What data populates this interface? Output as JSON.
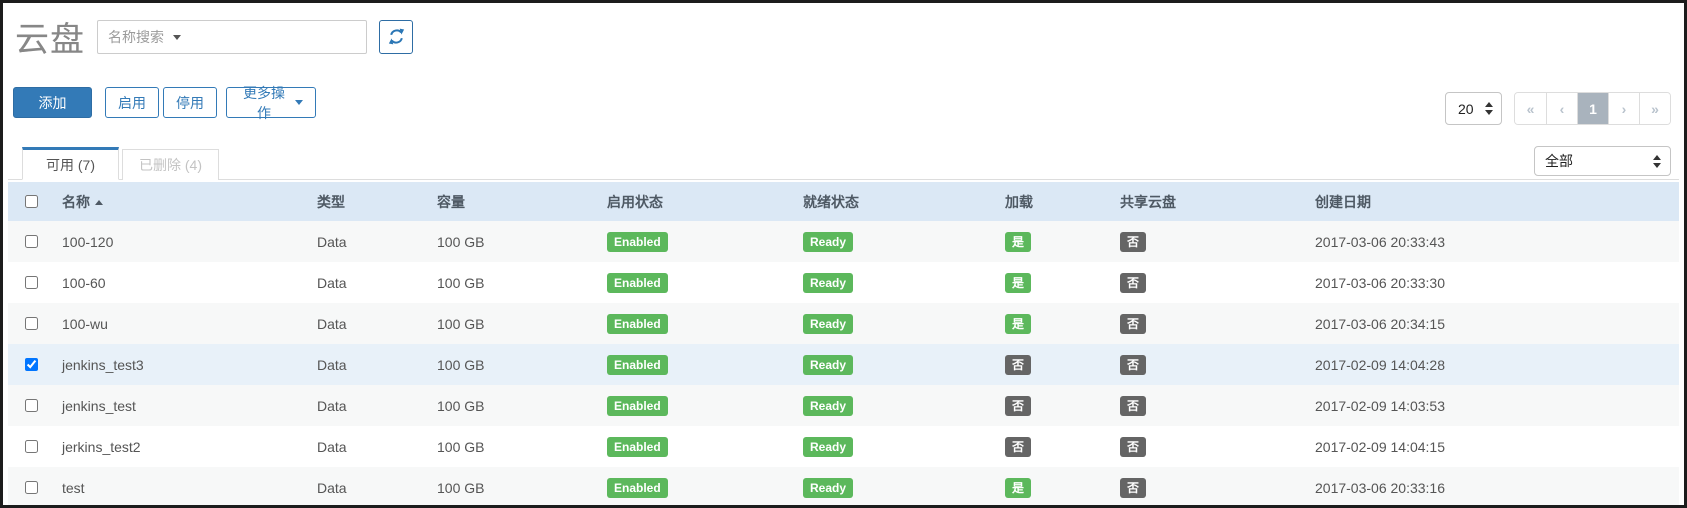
{
  "page": {
    "title": "云盘"
  },
  "search": {
    "placeholder": "名称搜索"
  },
  "toolbar": {
    "add_label": "添加",
    "enable_label": "启用",
    "disable_label": "停用",
    "more_label": "更多操作"
  },
  "pagination": {
    "page_size": "20",
    "first": "«",
    "prev": "‹",
    "current_page": "1",
    "next": "›",
    "last": "»"
  },
  "tabs": [
    {
      "label": "可用 (7)",
      "active": true
    },
    {
      "label": "已删除 (4)",
      "active": false
    }
  ],
  "filter": {
    "selected": "全部"
  },
  "table": {
    "headers": {
      "name": "名称",
      "type": "类型",
      "capacity": "容量",
      "enable_status": "启用状态",
      "ready_status": "就绪状态",
      "attached": "加载",
      "shared": "共享云盘",
      "created": "创建日期"
    },
    "rows": [
      {
        "name": "100-120",
        "type": "Data",
        "capacity": "100 GB",
        "enable_status": "Enabled",
        "ready_status": "Ready",
        "attached": "是",
        "shared": "否",
        "created": "2017-03-06 20:33:43",
        "checked": false
      },
      {
        "name": "100-60",
        "type": "Data",
        "capacity": "100 GB",
        "enable_status": "Enabled",
        "ready_status": "Ready",
        "attached": "是",
        "shared": "否",
        "created": "2017-03-06 20:33:30",
        "checked": false
      },
      {
        "name": "100-wu",
        "type": "Data",
        "capacity": "100 GB",
        "enable_status": "Enabled",
        "ready_status": "Ready",
        "attached": "是",
        "shared": "否",
        "created": "2017-03-06 20:34:15",
        "checked": false
      },
      {
        "name": "jenkins_test3",
        "type": "Data",
        "capacity": "100 GB",
        "enable_status": "Enabled",
        "ready_status": "Ready",
        "attached": "否",
        "shared": "否",
        "created": "2017-02-09 14:04:28",
        "checked": true
      },
      {
        "name": "jenkins_test",
        "type": "Data",
        "capacity": "100 GB",
        "enable_status": "Enabled",
        "ready_status": "Ready",
        "attached": "否",
        "shared": "否",
        "created": "2017-02-09 14:03:53",
        "checked": false
      },
      {
        "name": "jerkins_test2",
        "type": "Data",
        "capacity": "100 GB",
        "enable_status": "Enabled",
        "ready_status": "Ready",
        "attached": "否",
        "shared": "否",
        "created": "2017-02-09 14:04:15",
        "checked": false
      },
      {
        "name": "test",
        "type": "Data",
        "capacity": "100 GB",
        "enable_status": "Enabled",
        "ready_status": "Ready",
        "attached": "是",
        "shared": "否",
        "created": "2017-03-06 20:33:16",
        "checked": false
      }
    ]
  },
  "colors": {
    "primary_blue": "#337ab7",
    "header_bg": "#dbe8f5",
    "selected_row_bg": "#e8f1f9",
    "stripe_bg": "#f7f8f8",
    "badge_green": "#5cb85c",
    "badge_dark": "#656565",
    "active_page_bg": "#a9b3bd"
  }
}
